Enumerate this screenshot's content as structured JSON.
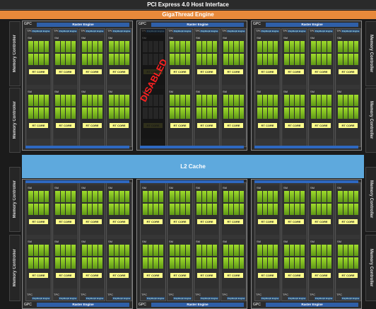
{
  "header": {
    "host_interface": "PCI Express 4.0 Host Interface",
    "giga_thread": "GigaThread Engine"
  },
  "memory_controller_label": "Memory Controller",
  "l2_cache": "L2 Cache",
  "gpc": {
    "label": "GPC",
    "raster_engine": "Raster Engine",
    "tpc_label": "TPC",
    "polymorph": "PolyMorph Engine",
    "sm_label": "SM",
    "rt_core": "RT CORE"
  },
  "disabled_label": "DISABLED",
  "colors": {
    "giga": "#e8893a",
    "l2": "#5ea9dd",
    "raster": "#2f5fa8",
    "core": "#8bc34a",
    "rt": "#ffff8c",
    "disabled_text": "#ff2020"
  }
}
